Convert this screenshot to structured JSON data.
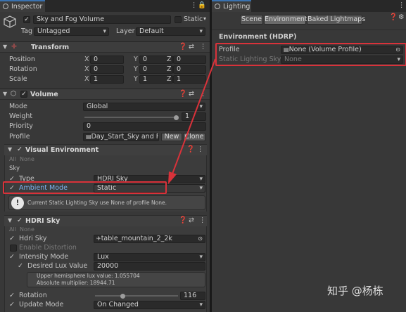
{
  "inspector": {
    "tab_label": "Inspector",
    "object_name": "Sky and Fog Volume",
    "static_label": "Static",
    "tag_label": "Tag",
    "tag_value": "Untagged",
    "layer_label": "Layer",
    "layer_value": "Default",
    "transform": {
      "title": "Transform",
      "rows": [
        {
          "label": "Position",
          "x": "0",
          "y": "0",
          "z": "0"
        },
        {
          "label": "Rotation",
          "x": "0",
          "y": "0",
          "z": "0"
        },
        {
          "label": "Scale",
          "x": "1",
          "y": "1",
          "z": "1"
        }
      ],
      "axis_x": "X",
      "axis_y": "Y",
      "axis_z": "Z"
    },
    "volume": {
      "title": "Volume",
      "mode_label": "Mode",
      "mode_value": "Global",
      "weight_label": "Weight",
      "weight_value": "1",
      "weight_level": 1,
      "priority_label": "Priority",
      "priority_value": "0",
      "profile_label": "Profile",
      "profile_value": "Day_Start_Sky and F",
      "new_button": "New",
      "clone_button": "Clone"
    },
    "visual_environment": {
      "title": "Visual Environment",
      "all_label": "All",
      "none_label": "None",
      "sky_section": "Sky",
      "type_label": "Type",
      "type_value": "HDRI Sky",
      "ambient_label": "Ambient Mode",
      "ambient_value": "Static",
      "help_text": "Current Static Lighting Sky use None of profile None."
    },
    "hdri_sky": {
      "title": "HDRI Sky",
      "all_label": "All",
      "none_label": "None",
      "hdri_label": "Hdri Sky",
      "hdri_value": "table_mountain_2_2k",
      "distortion_label": "Enable Distortion",
      "intensity_mode_label": "Intensity Mode",
      "intensity_mode_value": "Lux",
      "lux_label": "Desired Lux Value",
      "lux_value": "20000",
      "help_line1": "Upper hemisphere lux value: 1.055704",
      "help_line2": "Absolute multiplier: 18944.71",
      "rotation_label": "Rotation",
      "rotation_value": "116",
      "rotation_level": 0.322,
      "update_mode_label": "Update Mode",
      "update_mode_value": "On Changed"
    }
  },
  "lighting": {
    "tab_label": "Lighting",
    "tabs": [
      "Scene",
      "Environment",
      "Baked Lightmaps"
    ],
    "section_title": "Environment (HDRP)",
    "profile_label": "Profile",
    "profile_value": "None (Volume Profile)",
    "static_sky_label": "Static Lighting Sky",
    "static_sky_value": "None"
  },
  "watermark": "知乎 @杨栋",
  "colors": {
    "annotation_red": "#d9323a",
    "tab_accent": "#3a72b0",
    "panel_bg": "#383838"
  }
}
